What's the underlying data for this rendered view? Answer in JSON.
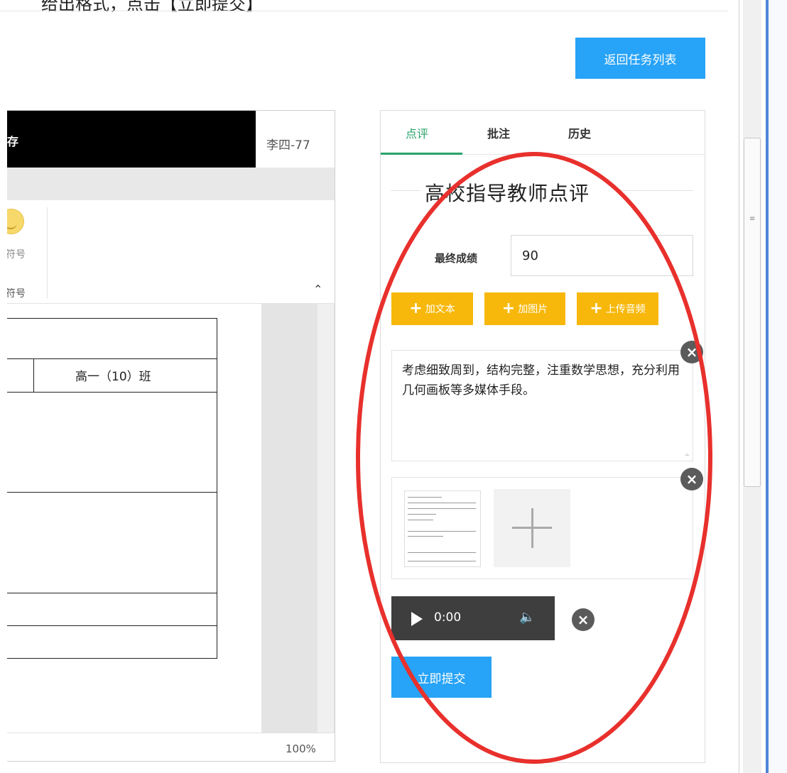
{
  "instruction": "给出格式，点击【立即提交】",
  "header": {
    "back_label": "返回任务列表"
  },
  "editor": {
    "save_label": "保存",
    "user": "李四-77",
    "ribbon_item_1": "符号",
    "ribbon_item_2": "符号",
    "table_class": "高一（10）班",
    "zoom": "100%"
  },
  "panel": {
    "tabs": [
      {
        "label": "点评",
        "active": true
      },
      {
        "label": "批注",
        "active": false
      },
      {
        "label": "历史",
        "active": false
      }
    ],
    "title": "高校指导教师点评",
    "score_label": "最终成绩",
    "score_value": "90",
    "buttons": {
      "add_text": "加文本",
      "add_image": "加图片",
      "upload_audio": "上传音频"
    },
    "comment": "考虑细致周到，结构完整，注重数学思想，充分利用几何画板等多媒体手段。",
    "audio_time": "0:00",
    "submit_label": "立即提交"
  },
  "colors": {
    "accent_blue": "#27a3f7",
    "button_yellow": "#f7b80b",
    "tab_green": "#2aa36a",
    "annotation_red": "#e8302c"
  },
  "icons": [
    "smiley-icon",
    "plus-icon",
    "close-icon",
    "play-icon",
    "volume-icon",
    "chevron-up-icon"
  ]
}
